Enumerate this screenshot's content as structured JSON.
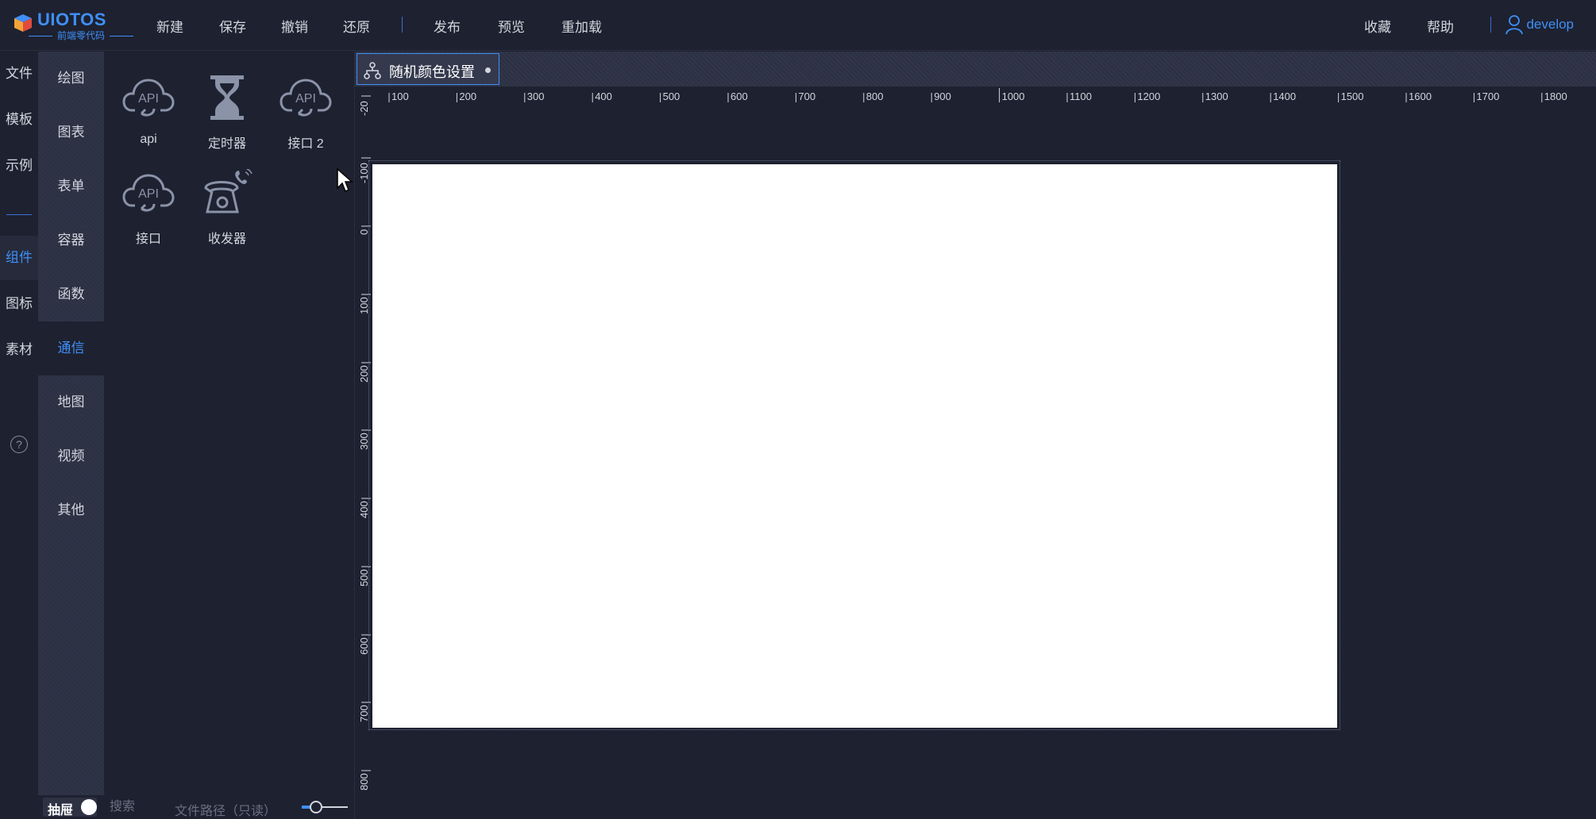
{
  "logo": {
    "brand": "UIOTOS",
    "tagline": "前端零代码"
  },
  "topmenu": {
    "left": [
      {
        "label": "新建",
        "icon": ""
      },
      {
        "label": "保存"
      },
      {
        "label": "撤销"
      },
      {
        "label": "还原"
      },
      {
        "label": "发布"
      },
      {
        "label": "预览"
      },
      {
        "label": "重加载"
      }
    ],
    "right": [
      {
        "label": "收藏"
      },
      {
        "label": "帮助"
      }
    ],
    "user": "develop"
  },
  "rail1": {
    "items": [
      "文件",
      "模板",
      "示例",
      "组件",
      "图标",
      "素材"
    ],
    "active": "组件",
    "help": "?"
  },
  "rail2": {
    "items": [
      "绘图",
      "图表",
      "表单",
      "容器",
      "函数",
      "通信",
      "地图",
      "视频",
      "其他"
    ],
    "active": "通信"
  },
  "components": [
    {
      "label": "api",
      "icon": "api-cloud-icon"
    },
    {
      "label": "定时器",
      "icon": "hourglass-icon"
    },
    {
      "label": "接口 2",
      "icon": "api-cloud-icon"
    },
    {
      "label": "接口",
      "icon": "api-cloud-icon"
    },
    {
      "label": "收发器",
      "icon": "telephone-icon"
    }
  ],
  "bottombar": {
    "drawer_label": "抽屉",
    "drawer_on": true,
    "search_placeholder": "搜索",
    "filepath_placeholder": "文件路径（只读）",
    "zoom_level": 0.15
  },
  "editor": {
    "tab_title": "随机颜色设置",
    "tab_icon": "network-icon",
    "hruler_labels": [
      "100",
      "200",
      "300",
      "400",
      "500",
      "600",
      "700",
      "800",
      "900",
      "1000",
      "1100",
      "1200",
      "1300",
      "1400",
      "1500",
      "1600",
      "1700",
      "1800"
    ],
    "vruler_labels": [
      "-20",
      "-100",
      "0",
      "100",
      "200",
      "300",
      "400",
      "500",
      "600",
      "700",
      "800"
    ]
  },
  "colors": {
    "accent": "#3f8ff7",
    "background": "#1e2130",
    "panel": "#2b3043",
    "canvas": "#ffffff"
  }
}
